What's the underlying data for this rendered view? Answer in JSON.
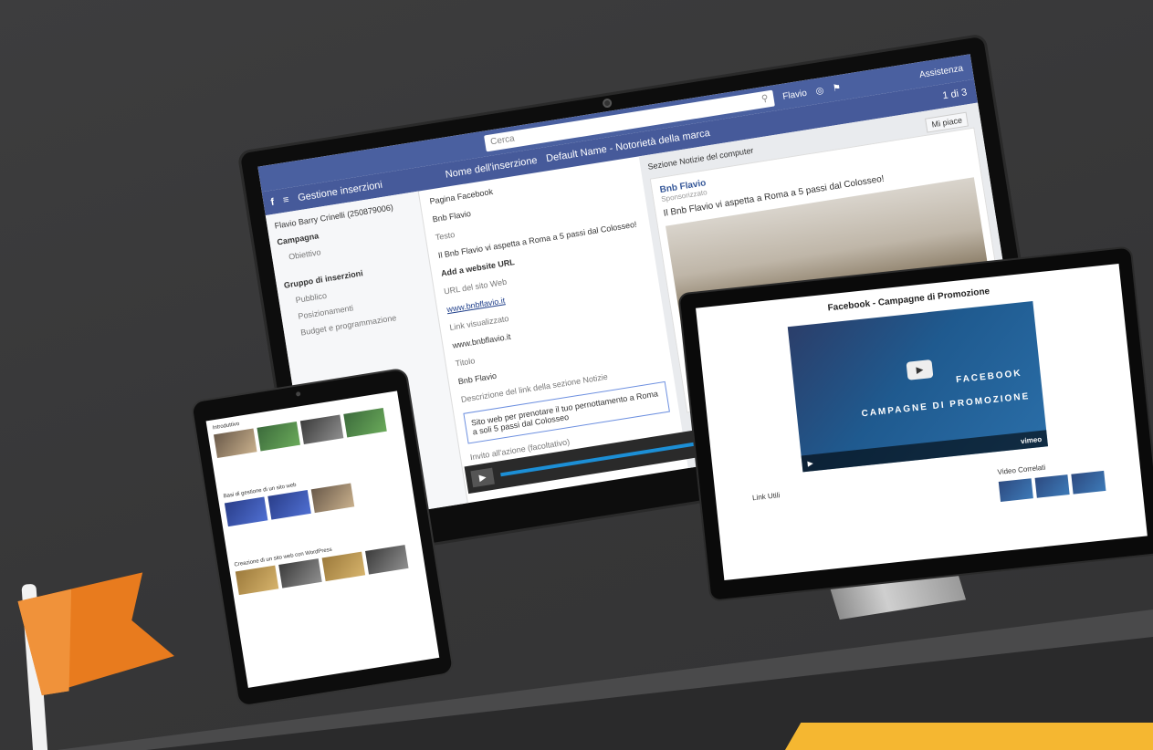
{
  "desktop": {
    "search_placeholder": "Cerca",
    "user": "Flavio",
    "help": "Assistenza",
    "app_title": "Gestione inserzioni",
    "account": "Flavio Barry Crinelli (250879006)",
    "ad_name_label": "Nome dell'inserzione",
    "ad_name_value": "Default Name - Notorietà della marca",
    "preview_select": "Sezione Notizie del computer",
    "pagination": "1 di 3",
    "like_button": "Mi piace",
    "sidebar": {
      "campaign": "Campagna",
      "objective": "Obiettivo",
      "adset": "Gruppo di inserzioni",
      "audience": "Pubblico",
      "placements": "Posizionamenti",
      "budget": "Budget e programmazione"
    },
    "form": {
      "fb_page_label": "Pagina Facebook",
      "fb_page_value": "Bnb Flavio",
      "text_label": "Testo",
      "text_value": "Il Bnb Flavio vi aspetta a Roma a 5 passi dal Colosseo!",
      "add_url": "Add a website URL",
      "url_label": "URL del sito Web",
      "url_value": "www.bnbflavio.it",
      "display_link_label": "Link visualizzato",
      "display_link_value": "www.bnbflavio.it",
      "title_label": "Titolo",
      "title_value": "Bnb Flavio",
      "desc_label": "Descrizione del link della sezione Notizie",
      "desc_value": "Sito web per prenotare il tuo pernottamento a Roma a soli 5 passi dal Colosseo",
      "cta_label": "Invito all'azione (facoltativo)"
    },
    "preview": {
      "page_name": "Bnb Flavio",
      "sponsored": "Sponsorizzato",
      "post_text": "Il Bnb Flavio vi aspetta a Roma a 5 passi dal Colosseo!"
    }
  },
  "laptop": {
    "title": "Facebook - Campagne di Promozione",
    "video_line1": "FACEBOOK",
    "video_line2": "CAMPAGNE DI PROMOZIONE",
    "video_brand": "vimeo",
    "related_title": "Video Correlati",
    "links_title": "Link Utili"
  },
  "tablet": {
    "sec1": "Introduttivo",
    "sec2": "Basi di gestione di un sito web",
    "sec3": "Creazione di un sito web con WordPress"
  },
  "colors": {
    "background": "#3a3a3b",
    "facebook_blue": "#4a60a0",
    "flag_orange": "#e87b1e",
    "accent_yellow": "#f5b731"
  }
}
